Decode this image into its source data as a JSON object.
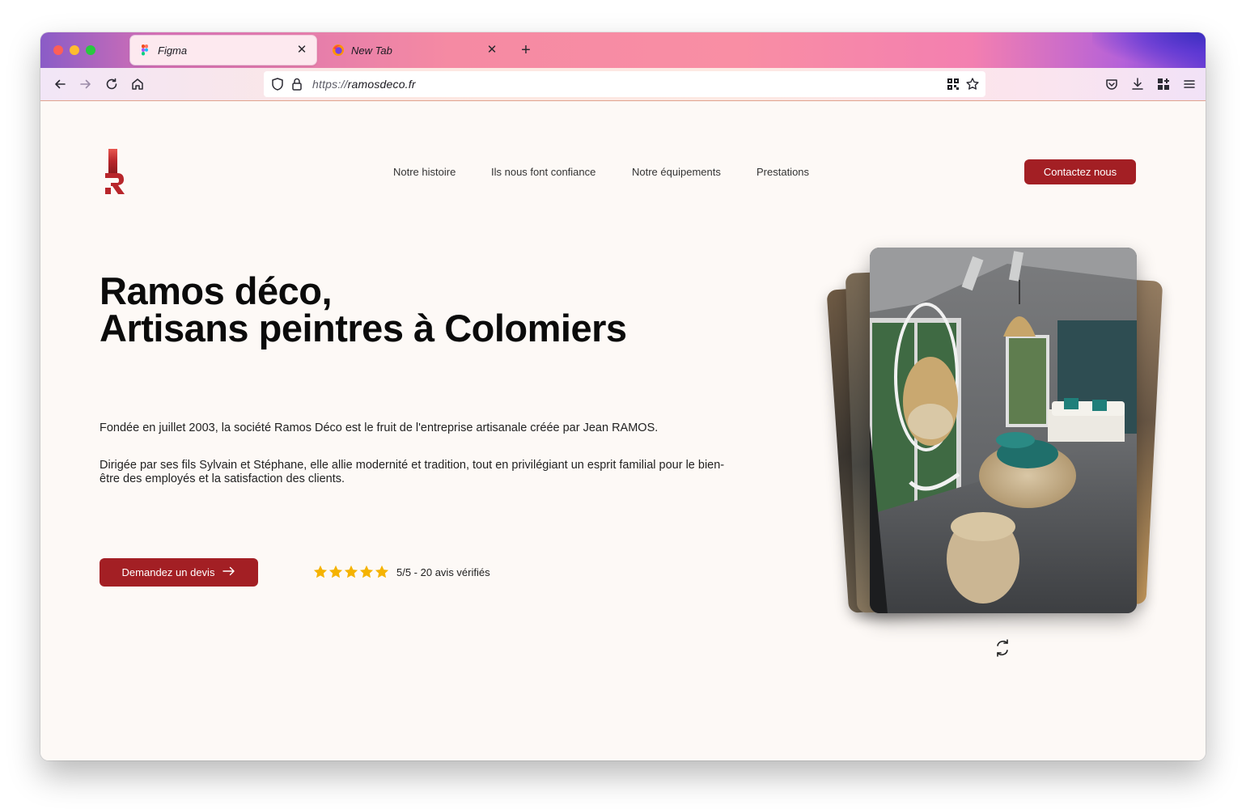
{
  "browser": {
    "tabs": [
      {
        "title": "Figma",
        "active": true
      },
      {
        "title": "New Tab",
        "active": false
      }
    ],
    "url_protocol": "https://",
    "url_host": "ramosdeco.fr",
    "toolbar_icons": [
      "back-icon",
      "forward-icon",
      "reload-icon",
      "home-icon",
      "shield-icon",
      "lock-icon",
      "qr-code-icon",
      "bookmark-star-icon",
      "pocket-icon",
      "download-icon",
      "extensions-icon",
      "menu-icon"
    ]
  },
  "site": {
    "nav": [
      "Notre histoire",
      "Ils nous font confiance",
      "Notre équipements",
      "Prestations"
    ],
    "contact_button": "Contactez nous",
    "hero": {
      "title_line1": "Ramos déco,",
      "title_line2": "Artisans peintres à Colomiers",
      "paragraph1": "Fondée en juillet 2003, la société Ramos Déco est le fruit de l'entreprise artisanale créée par Jean RAMOS.",
      "paragraph2": "Dirigée par ses fils Sylvain et Stéphane, elle allie modernité et tradition, tout en privilégiant un esprit familial pour le bien-être des employés et la satisfaction des clients.",
      "quote_button": "Demandez un devis",
      "rating_stars": 5,
      "rating_text": "5/5 - 20 avis vérifiés"
    },
    "colors": {
      "brand_red": "#a31f24",
      "page_bg": "#fdf9f6",
      "star": "#f5b301"
    }
  }
}
